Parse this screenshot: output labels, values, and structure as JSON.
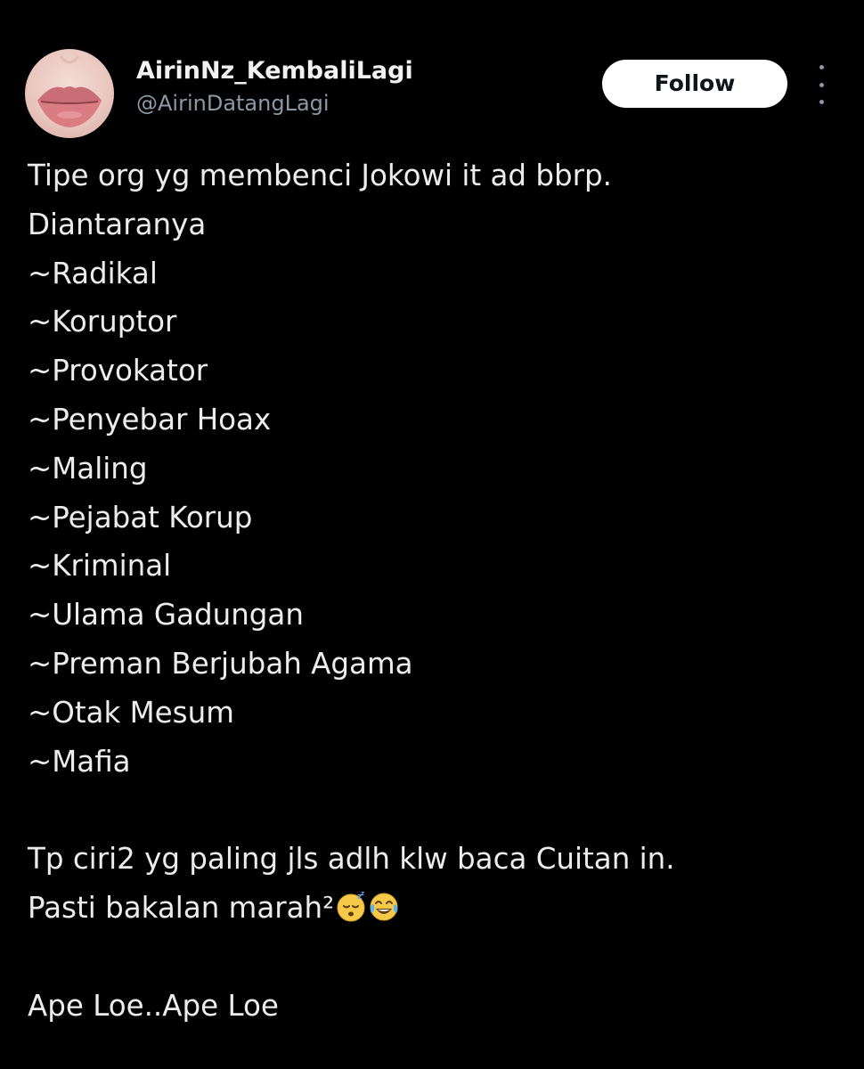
{
  "tweet": {
    "display_name": "AirinNz_KembaliLagi",
    "handle": "@AirinDatangLagi",
    "follow_label": "Follow",
    "more_icon": "more-vertical-icon",
    "avatar_icon": "lips-avatar",
    "lines": [
      "Tipe org yg membenci Jokowi it ad bbrp.",
      "Diantaranya",
      "~Radikal",
      "~Koruptor",
      "~Provokator",
      "~Penyebar Hoax",
      "~Maling",
      "~Pejabat Korup",
      "~Kriminal",
      "~Ulama Gadungan",
      "~Preman Berjubah Agama",
      "~Otak Mesum",
      "~Mafia"
    ],
    "line2": "Tp ciri2 yg paling jls adlh klw baca Cuitan in.",
    "line3": "Pasti bakalan marah²",
    "emojis": [
      "sleeping-face-emoji",
      "tears-of-joy-emoji"
    ],
    "closing": "Ape Loe..Ape Loe"
  },
  "colors": {
    "background": "#000000",
    "text": "#ececec",
    "secondary": "#8b98a5",
    "button_bg": "#ffffff",
    "button_text": "#0f1419"
  }
}
